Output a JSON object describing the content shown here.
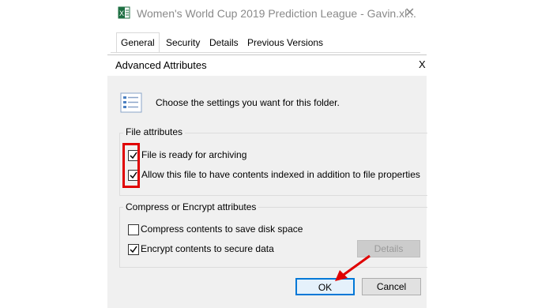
{
  "properties_window": {
    "title": "Women's World Cup 2019 Prediction League - Gavin.xl...",
    "app_icon": "excel-icon",
    "close_glyph": "✕",
    "tabs": [
      {
        "label": "General"
      },
      {
        "label": "Security"
      },
      {
        "label": "Details"
      },
      {
        "label": "Previous Versions"
      }
    ]
  },
  "dialog": {
    "title": "Advanced Attributes",
    "close_glyph": "X",
    "info_text": "Choose the settings you want for this folder.",
    "file_attributes": {
      "label": "File attributes",
      "options": [
        {
          "label": "File is ready for archiving",
          "checked": true
        },
        {
          "label": "Allow this file to have contents indexed in addition to file properties",
          "checked": true
        }
      ]
    },
    "compress_encrypt": {
      "label": "Compress or Encrypt attributes",
      "options": [
        {
          "label": "Compress contents to save disk space",
          "checked": false
        },
        {
          "label": "Encrypt contents to secure data",
          "checked": true
        }
      ],
      "details_label": "Details"
    },
    "ok_label": "OK",
    "cancel_label": "Cancel"
  },
  "colors": {
    "highlight": "#e00000",
    "accent": "#0078d7",
    "dialog_bg": "#f0f0f0"
  }
}
